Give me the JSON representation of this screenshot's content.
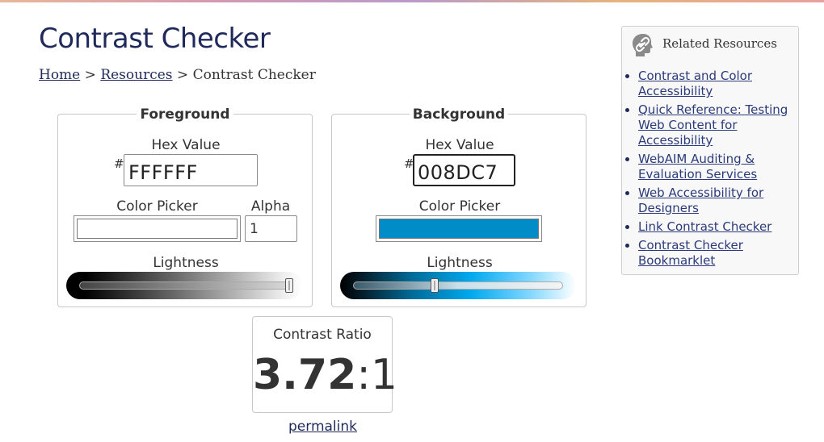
{
  "header": {
    "title": "Contrast Checker",
    "breadcrumb": {
      "home": "Home",
      "sep1": ">",
      "resources": "Resources",
      "sep2": ">",
      "current": "Contrast Checker"
    }
  },
  "foreground": {
    "legend": "Foreground",
    "hex_label": "Hex Value",
    "hash": "#",
    "hex_value": "FFFFFF",
    "picker_label": "Color Picker",
    "picker_color": "#ffffff",
    "alpha_label": "Alpha",
    "alpha_value": "1",
    "lightness_label": "Lightness",
    "lightness_fraction": 1.0
  },
  "background": {
    "legend": "Background",
    "hex_label": "Hex Value",
    "hash": "#",
    "hex_value": "008DC7",
    "picker_label": "Color Picker",
    "picker_color": "#008dc7",
    "lightness_label": "Lightness",
    "lightness_fraction": 0.39
  },
  "result": {
    "label": "Contrast Ratio",
    "ratio_bold": "3.72",
    "ratio_suffix": ":1",
    "permalink": "permalink"
  },
  "related": {
    "title": "Related Resources",
    "icon": "link-head-icon",
    "items": [
      {
        "label": "Contrast and Color Accessibility"
      },
      {
        "label": "Quick Reference: Testing Web Content for Accessibility"
      },
      {
        "label": "WebAIM Auditing & Evaluation Services"
      },
      {
        "label": "Web Accessibility for Designers"
      },
      {
        "label": "Link Contrast Checker"
      },
      {
        "label": "Contrast Checker Bookmarklet"
      }
    ]
  },
  "colors": {
    "title": "#1f2a5a",
    "link": "#2b3a7a",
    "accent": "#008dc7"
  }
}
